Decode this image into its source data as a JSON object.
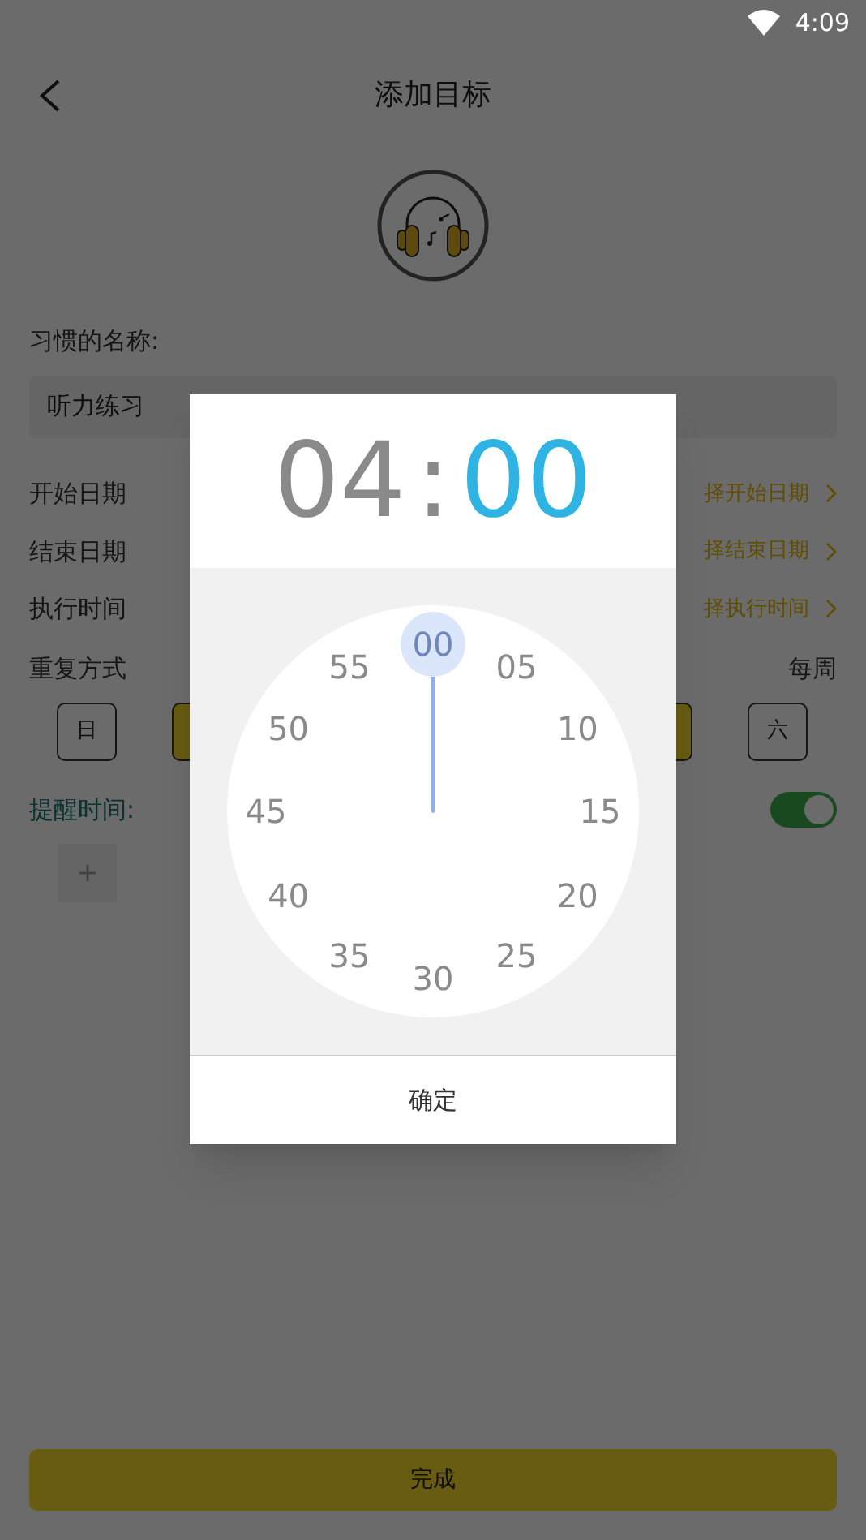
{
  "status_bar": {
    "time": "4:09"
  },
  "header": {
    "title": "添加目标"
  },
  "name_label": "习惯的名称:",
  "name_field": {
    "value": "听力练习"
  },
  "rows": [
    {
      "label": "开始日期",
      "value": "择开始日期"
    },
    {
      "label": "结束日期",
      "value": "择结束日期"
    },
    {
      "label": "执行时间",
      "value": "择执行时间"
    }
  ],
  "repeat": {
    "label": "重复方式",
    "value": "每周",
    "days": [
      {
        "label": "日",
        "selected": false
      },
      {
        "selected": true
      },
      {
        "selected": true
      },
      {
        "label": "六",
        "selected": false
      }
    ]
  },
  "reminder": {
    "label": "提醒时间:",
    "on": true,
    "add": "+"
  },
  "done_button": "完成",
  "dialog": {
    "hour": "04",
    "separator": ":",
    "minute": "00",
    "dial": [
      {
        "label": "00",
        "selected": true
      },
      {
        "label": "05",
        "selected": false
      },
      {
        "label": "10",
        "selected": false
      },
      {
        "label": "15",
        "selected": false
      },
      {
        "label": "20",
        "selected": false
      },
      {
        "label": "25",
        "selected": false
      },
      {
        "label": "30",
        "selected": false
      },
      {
        "label": "35",
        "selected": false
      },
      {
        "label": "40",
        "selected": false
      },
      {
        "label": "45",
        "selected": false
      },
      {
        "label": "50",
        "selected": false
      },
      {
        "label": "55",
        "selected": false
      }
    ],
    "ok_button": "确定"
  }
}
